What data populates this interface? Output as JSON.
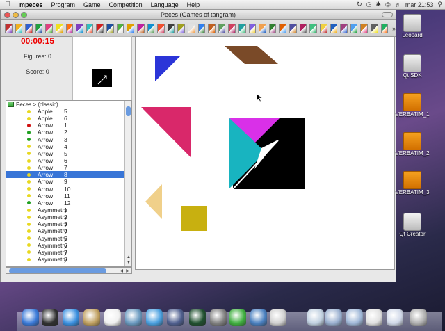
{
  "menubar": {
    "apple_icon": "apple-icon",
    "app_name": "mpeces",
    "menus": [
      "Program",
      "Game",
      "Competition",
      "Language",
      "Help"
    ],
    "clock": "mar 21:53"
  },
  "window": {
    "title": "Peces (Games of tangram)"
  },
  "toolbar": {
    "icon_colors": [
      "#c03030",
      "#f0b020",
      "#3060d0",
      "#20a040",
      "#e04080",
      "#f0e020",
      "#ff7010",
      "#8040c0",
      "#30c0c0",
      "#d02020",
      "#2050a0",
      "#50b040",
      "#e0a000",
      "#c020a0",
      "#1090d0",
      "#f05030",
      "#404040",
      "#a0a020",
      "#e0e0e0",
      "#3080f0",
      "#c06020",
      "#60a060",
      "#d04060",
      "#20a0a0",
      "#8060e0",
      "#f0a050",
      "#308030",
      "#e06000",
      "#5050a0",
      "#b02060",
      "#40c080",
      "#f0d040",
      "#2060c0",
      "#a04080",
      "#50a0f0",
      "#d08020",
      "#606060",
      "#20b060"
    ],
    "more_glyph": "»"
  },
  "game": {
    "timer": "00:00:15",
    "figures_label": "Figures: 0",
    "score_label": "Score: 0"
  },
  "tree": {
    "header": "Peces > (classic)",
    "items": [
      {
        "name": "Apple",
        "num": "5",
        "dot": "#e8d820"
      },
      {
        "name": "Apple",
        "num": "6",
        "dot": "#e8d820"
      },
      {
        "name": "Arrow",
        "num": "1",
        "dot": "#d01010"
      },
      {
        "name": "Arrow",
        "num": "2",
        "dot": "#20a020"
      },
      {
        "name": "Arrow",
        "num": "3",
        "dot": "#20a020"
      },
      {
        "name": "Arrow",
        "num": "4",
        "dot": "#e8d820"
      },
      {
        "name": "Arrow",
        "num": "5",
        "dot": "#e8d820"
      },
      {
        "name": "Arrow",
        "num": "6",
        "dot": "#e8d820"
      },
      {
        "name": "Arrow",
        "num": "7",
        "dot": "#e8d820"
      },
      {
        "name": "Arrow",
        "num": "8",
        "dot": "#e8d820",
        "selected": true
      },
      {
        "name": "Arrow",
        "num": "9",
        "dot": "#e8d820"
      },
      {
        "name": "Arrow",
        "num": "10",
        "dot": "#e8d820"
      },
      {
        "name": "Arrow",
        "num": "11",
        "dot": "#e8d820"
      },
      {
        "name": "Arrow",
        "num": "12",
        "dot": "#20a020"
      },
      {
        "name": "Asymmetry",
        "num": "1",
        "dot": "#e8d820"
      },
      {
        "name": "Asymmetry",
        "num": "2",
        "dot": "#e8d820"
      },
      {
        "name": "Asymmetry",
        "num": "3",
        "dot": "#e8d820"
      },
      {
        "name": "Asymmetry",
        "num": "4",
        "dot": "#e8d820"
      },
      {
        "name": "Asymmetry",
        "num": "5",
        "dot": "#e8d820"
      },
      {
        "name": "Asymmetry",
        "num": "6",
        "dot": "#e8d820"
      },
      {
        "name": "Asymmetry",
        "num": "7",
        "dot": "#e8d820"
      },
      {
        "name": "Asymmetry",
        "num": "8",
        "dot": "#e8d820"
      }
    ]
  },
  "pieces": {
    "colors": {
      "blue": "#2b35d8",
      "brown": "#7a4a28",
      "crimson": "#d9286a",
      "magenta": "#d930e8",
      "cyan": "#18b4c0",
      "tan": "#f0d08a",
      "olive": "#c8b010",
      "target": "#000000"
    }
  },
  "desktop": {
    "items": [
      {
        "label": "Leopard",
        "kind": "drive"
      },
      {
        "label": "Qt SDK",
        "kind": "drive"
      },
      {
        "label": "VERBATIM_1",
        "kind": "usb"
      },
      {
        "label": "VERBATIM_2",
        "kind": "usb"
      },
      {
        "label": "VERBATIM_3",
        "kind": "usb"
      },
      {
        "label": "Qt Creator",
        "kind": "drive"
      }
    ]
  },
  "dock": {
    "apps": [
      {
        "name": "finder-icon",
        "color": "#3a7ad8"
      },
      {
        "name": "dashboard-icon",
        "color": "#303030"
      },
      {
        "name": "safari-icon",
        "color": "#3a90e0"
      },
      {
        "name": "address-book-icon",
        "color": "#c0a060"
      },
      {
        "name": "ical-icon",
        "color": "#f0f0f0"
      },
      {
        "name": "iphoto-icon",
        "color": "#6a9ac0"
      },
      {
        "name": "itunes-icon",
        "color": "#4aa0e0"
      },
      {
        "name": "spaces-icon",
        "color": "#506090"
      },
      {
        "name": "time-machine-icon",
        "color": "#205030"
      },
      {
        "name": "system-preferences-icon",
        "color": "#808080"
      },
      {
        "name": "qt-icon",
        "color": "#40b040"
      },
      {
        "name": "xcode-icon",
        "color": "#4a80c0"
      },
      {
        "name": "script-editor-icon",
        "color": "#d0d0d0"
      },
      {
        "name": "preview-icon",
        "color": "#c0d0e0"
      },
      {
        "name": "downloads-folder-icon",
        "color": "#9ab0d0"
      },
      {
        "name": "documents-folder-icon",
        "color": "#a0b8d8"
      },
      {
        "name": "stack-icon",
        "color": "#e0e0e0"
      },
      {
        "name": "stack2-icon",
        "color": "#d0d8e8"
      },
      {
        "name": "trash-icon",
        "color": "#b0b0b0"
      }
    ]
  }
}
